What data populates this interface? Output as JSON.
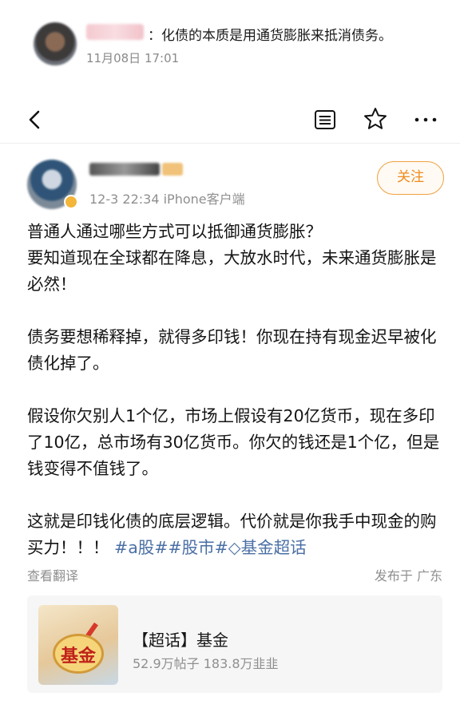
{
  "top_comment": {
    "text": "：化债的本质是用通货膨胀来抵消债务。",
    "time": "11月08日 17:01"
  },
  "navbar": {
    "icons": [
      "back-icon",
      "news-icon",
      "star-icon",
      "more-icon"
    ]
  },
  "author": {
    "meta": "12-3 22:34  iPhone客户端",
    "follow_label": "关注"
  },
  "post": {
    "paragraphs": [
      "普通人通过哪些方式可以抵御通货膨胀？\n要知道现在全球都在降息，大放水时代，未来通货膨胀是必然！",
      "债务要想稀释掉，就得多印钱！你现在持有现金迟早被化债化掉了。",
      "假设你欠别人1个亿，市场上假设有20亿货币，现在多印了10亿，总市场有30亿货币。你欠的钱还是1个亿，但是钱变得不值钱了。"
    ],
    "last_text": "这就是印钱化债的底层逻辑。代价就是你我手中现金的购买力！！！",
    "tags": "#a股##股市#◇基金超话"
  },
  "footer": {
    "translate": "查看翻译",
    "location": "发布于 广东"
  },
  "topic_card": {
    "image_text": "基金",
    "title": "【超话】基金",
    "stats": "52.9万帖子  183.8万韭韭"
  },
  "colors": {
    "accent_orange": "#f08a1c",
    "tag_blue": "#4a6fa5",
    "muted_gray": "#8f8f8f"
  }
}
